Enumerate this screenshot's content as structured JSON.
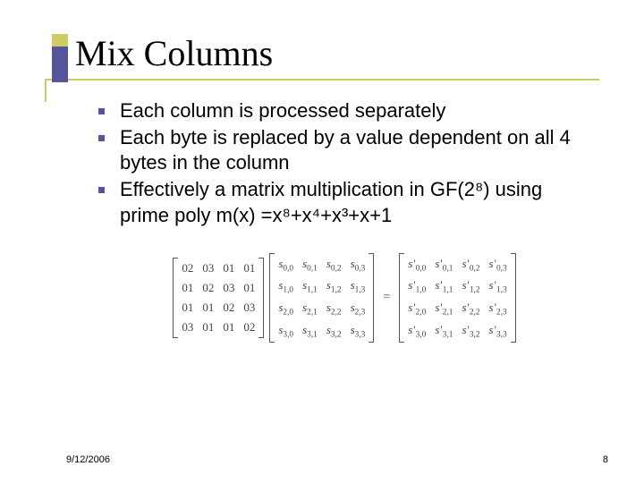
{
  "title": "Mix Columns",
  "bullets": [
    "Each column is processed separately",
    "Each byte is replaced by a value dependent on all 4 bytes in the column",
    "Effectively a matrix multiplication in GF(2⁸) using prime poly m(x) =x⁸+x⁴+x³+x+1"
  ],
  "matrix": {
    "coeff": [
      [
        "02",
        "03",
        "01",
        "01"
      ],
      [
        "01",
        "02",
        "03",
        "01"
      ],
      [
        "01",
        "01",
        "02",
        "03"
      ],
      [
        "03",
        "01",
        "01",
        "02"
      ]
    ],
    "state_sub": [
      [
        "0,0",
        "0,1",
        "0,2",
        "0,3"
      ],
      [
        "1,0",
        "1,1",
        "1,2",
        "1,3"
      ],
      [
        "2,0",
        "2,1",
        "2,2",
        "2,3"
      ],
      [
        "3,0",
        "3,1",
        "3,2",
        "3,3"
      ]
    ],
    "symbol": "s",
    "prime": "'",
    "equals": "="
  },
  "footer": {
    "date": "9/12/2006",
    "page": "8"
  }
}
